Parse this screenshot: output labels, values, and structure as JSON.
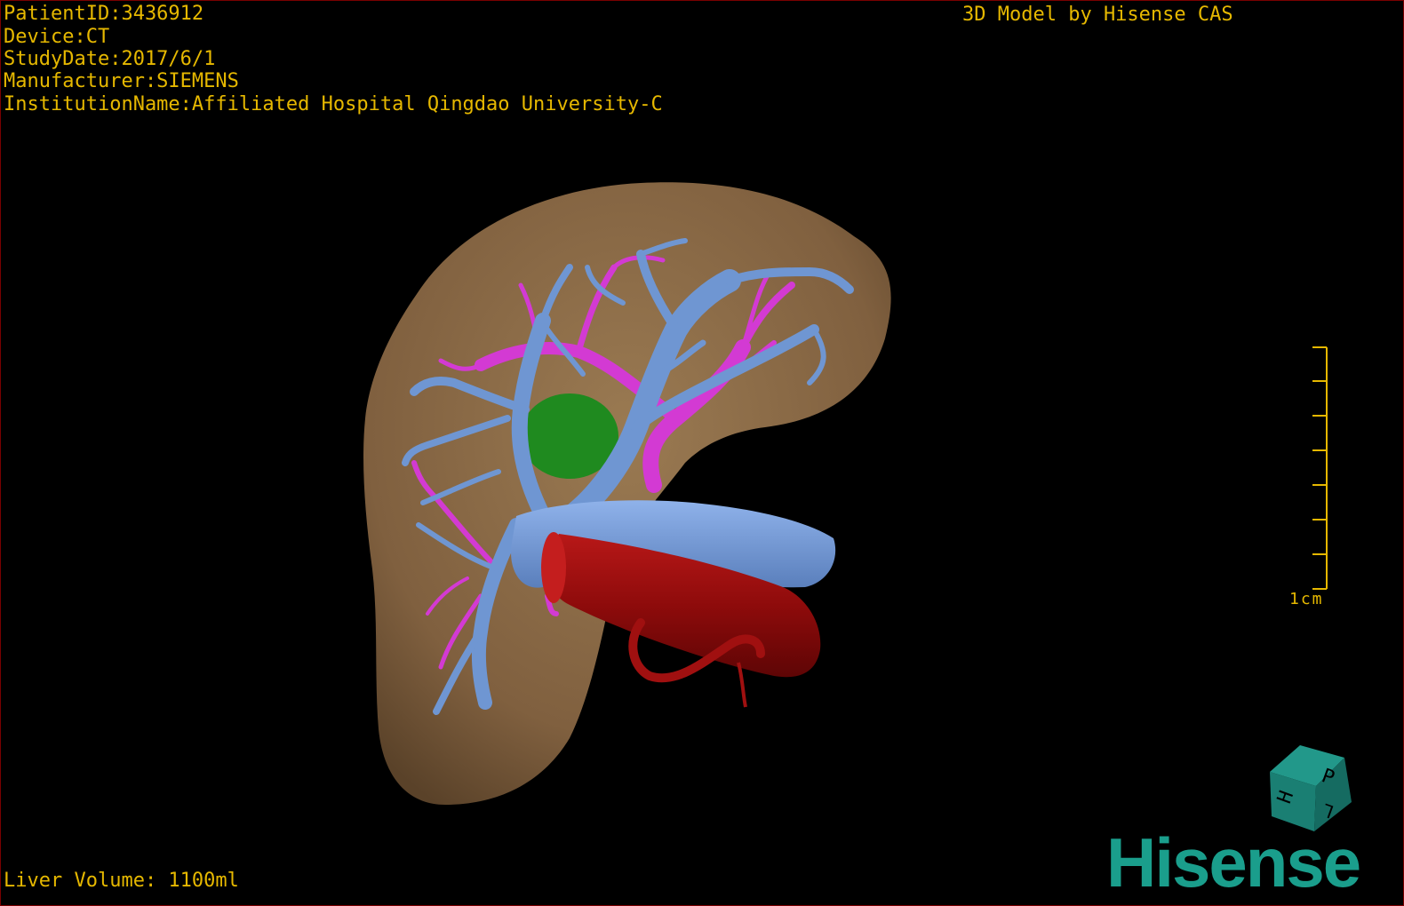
{
  "viewer": {
    "patient_info": [
      "PatientID:3436912",
      "Device:CT",
      "StudyDate:2017/6/1",
      "Manufacturer:SIEMENS",
      "InstitutionName:Affiliated Hospital Qingdao University-C"
    ],
    "credit": "3D Model by Hisense CAS",
    "liver_volume": "Liver Volume: 1100ml",
    "scale_label": "1cm",
    "brand": "Hisense",
    "orientation_cube_letters": [
      "P",
      "H",
      "L"
    ]
  },
  "colors": {
    "overlay_text": "#e6b800",
    "liver": "#8a6a45",
    "portal_vein": "#6f96d2",
    "hepatic_artery": "#d33ad3",
    "aorta": "#9a0f0f",
    "gallbladder": "#1f8a1f",
    "brand": "#1a9e8c",
    "cube": "#1a7f73"
  }
}
